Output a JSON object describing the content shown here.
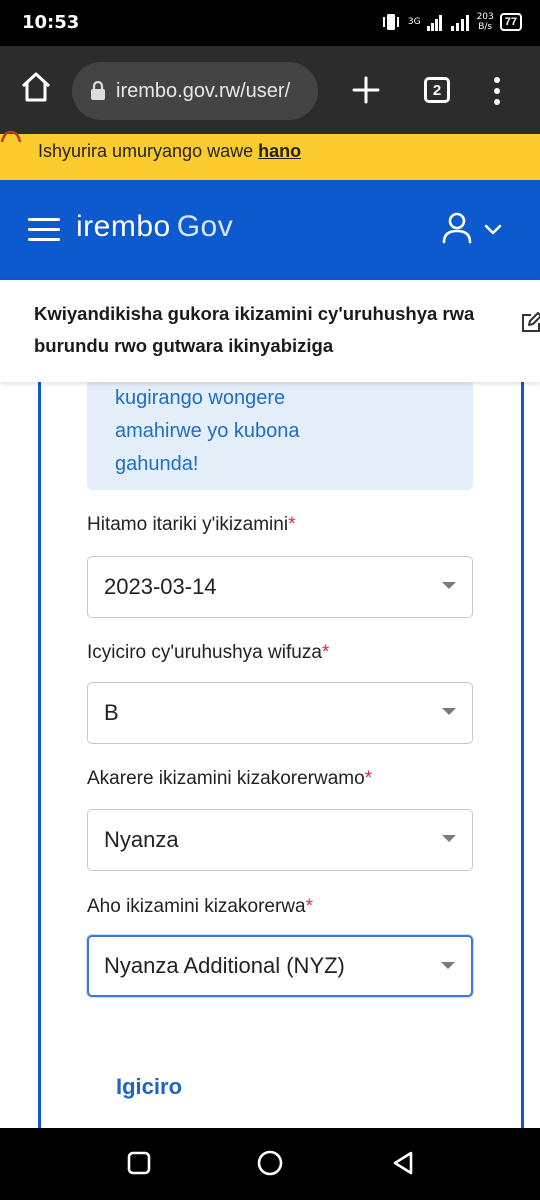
{
  "status_bar": {
    "time": "10:53",
    "network_type": "3G",
    "speed_value": "203",
    "speed_unit": "B/s",
    "battery": "77"
  },
  "browser": {
    "url": "irembo.gov.rw/user/",
    "tab_count": "2"
  },
  "banner": {
    "text": "Ishyurira umuryango wawe ",
    "link": "hano",
    "color": "#fccb2e"
  },
  "header": {
    "logo_brand": "irembo",
    "logo_suffix": "Gov",
    "color": "#0c5acd"
  },
  "page": {
    "title": "Kwiyandikisha gukora ikizamini cy'uruhushya rwa burundu rwo gutwara ikinyabiziga"
  },
  "info_box": {
    "lines": [
      "kugirango wongere",
      "amahirwe yo kubona",
      "gahunda!"
    ]
  },
  "form": {
    "fields": [
      {
        "label": "Hitamo itariki y'ikizamini",
        "value": "2023-03-14"
      },
      {
        "label": "Icyiciro cy'uruhushya wifuza",
        "value": "B"
      },
      {
        "label": "Akarere ikizamini kizakorerwamo",
        "value": "Nyanza"
      },
      {
        "label": "Aho ikizamini kizakorerwa",
        "value": "Nyanza Additional (NYZ)"
      }
    ],
    "required_mark": "*"
  },
  "section": {
    "title": "Igiciro"
  }
}
